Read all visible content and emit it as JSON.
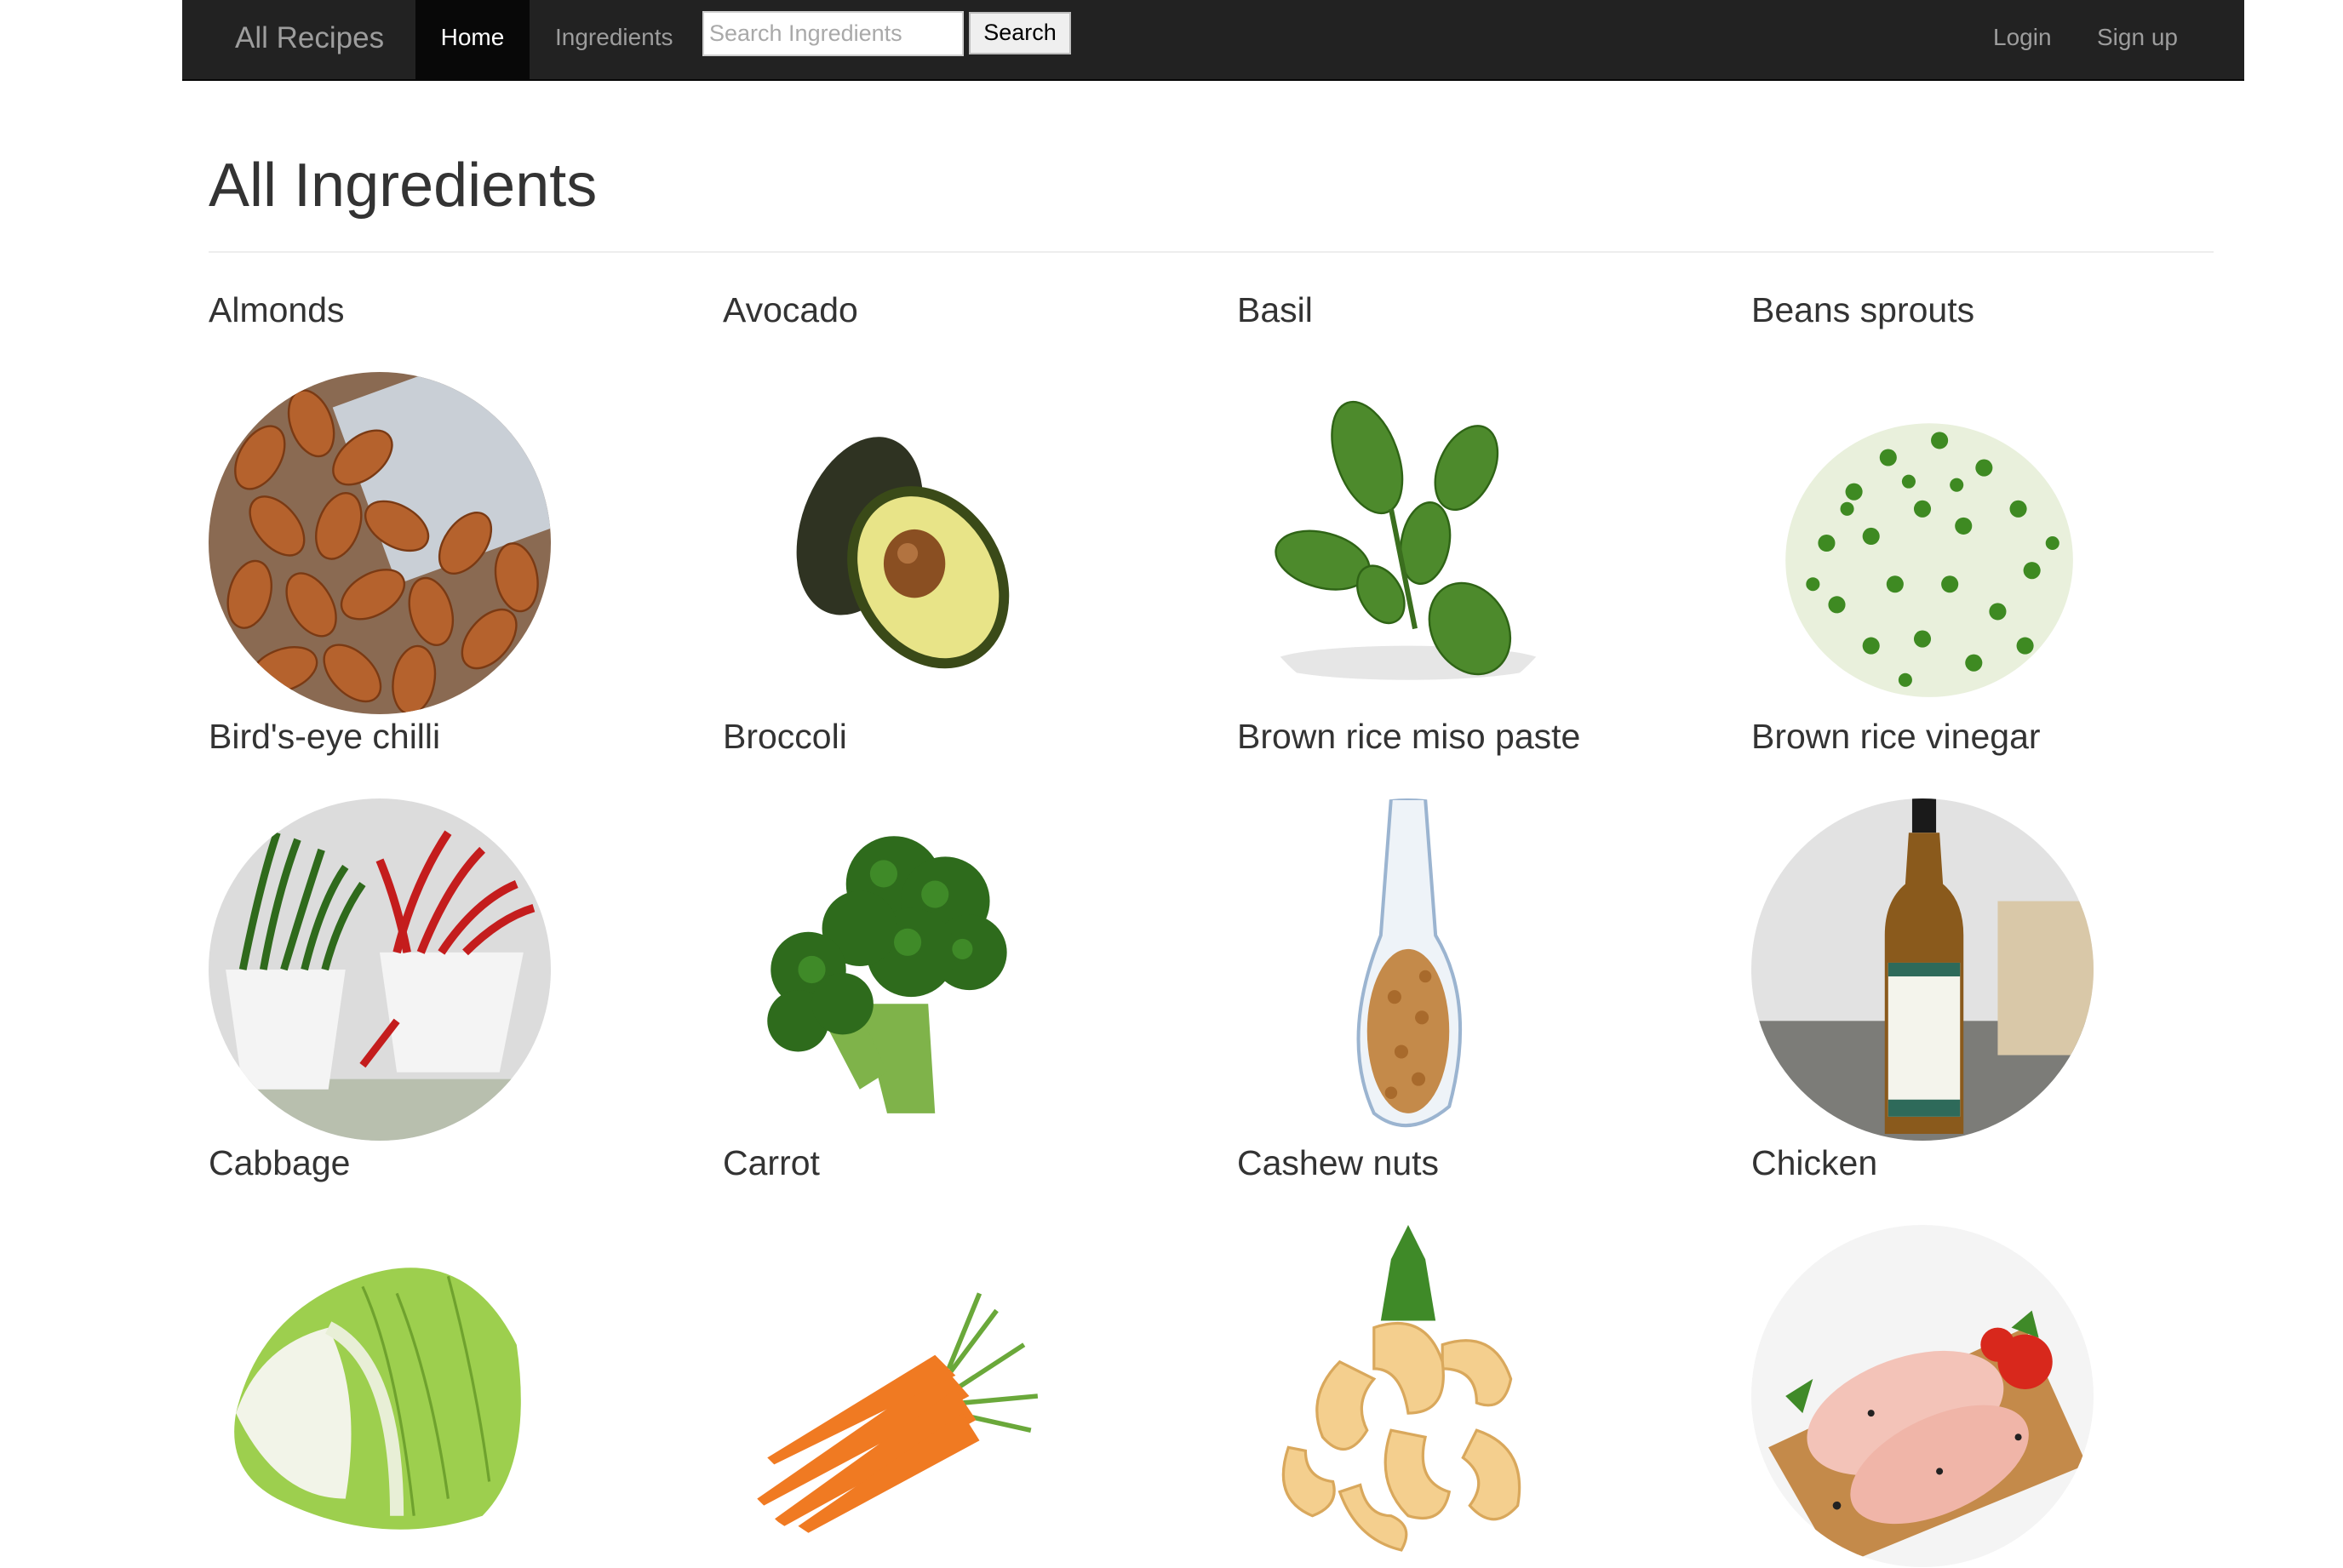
{
  "navbar": {
    "brand": "All Recipes",
    "home_label": "Home",
    "ingredients_label": "Ingredients",
    "search_placeholder": "Search Ingredients",
    "search_value": "",
    "search_button": "Search",
    "login_label": "Login",
    "signup_label": "Sign up",
    "background_color": "#222222",
    "active_color": "#080808"
  },
  "page": {
    "title": "All Ingredients"
  },
  "ingredients": [
    {
      "name": "Almonds",
      "image": "almonds-photo"
    },
    {
      "name": "Avocado",
      "image": "avocado-photo"
    },
    {
      "name": "Basil",
      "image": "basil-photo"
    },
    {
      "name": "Beans sprouts",
      "image": "bean-sprouts-photo"
    },
    {
      "name": "Bird's-eye chilli",
      "image": "chilli-photo"
    },
    {
      "name": "Broccoli",
      "image": "broccoli-photo"
    },
    {
      "name": "Brown rice miso paste",
      "image": "miso-paste-photo"
    },
    {
      "name": "Brown rice vinegar",
      "image": "vinegar-bottle-photo"
    },
    {
      "name": "Cabbage",
      "image": "cabbage-photo"
    },
    {
      "name": "Carrot",
      "image": "carrot-photo"
    },
    {
      "name": "Cashew nuts",
      "image": "cashew-photo"
    },
    {
      "name": "Chicken",
      "image": "chicken-photo"
    }
  ]
}
